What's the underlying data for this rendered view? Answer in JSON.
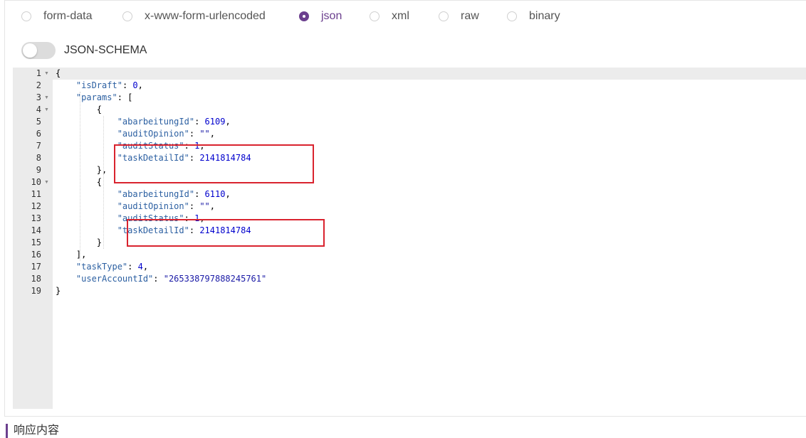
{
  "body_types": [
    {
      "label": "form-data",
      "checked": false
    },
    {
      "label": "x-www-form-urlencoded",
      "checked": false
    },
    {
      "label": "json",
      "checked": true
    },
    {
      "label": "xml",
      "checked": false
    },
    {
      "label": "raw",
      "checked": false
    },
    {
      "label": "binary",
      "checked": false
    }
  ],
  "schema_toggle": {
    "label": "JSON-SCHEMA",
    "on": false
  },
  "editor": {
    "lines": [
      [
        {
          "t": "p",
          "v": "{"
        }
      ],
      [
        {
          "t": "p",
          "v": "    "
        },
        {
          "t": "k",
          "v": "\"isDraft\""
        },
        {
          "t": "p",
          "v": ": "
        },
        {
          "t": "n",
          "v": "0"
        },
        {
          "t": "p",
          "v": ","
        }
      ],
      [
        {
          "t": "p",
          "v": "    "
        },
        {
          "t": "k",
          "v": "\"params\""
        },
        {
          "t": "p",
          "v": ": ["
        }
      ],
      [
        {
          "t": "p",
          "v": "        {"
        }
      ],
      [
        {
          "t": "p",
          "v": "            "
        },
        {
          "t": "k",
          "v": "\"abarbeitungId\""
        },
        {
          "t": "p",
          "v": ": "
        },
        {
          "t": "n",
          "v": "6109"
        },
        {
          "t": "p",
          "v": ","
        }
      ],
      [
        {
          "t": "p",
          "v": "            "
        },
        {
          "t": "k",
          "v": "\"auditOpinion\""
        },
        {
          "t": "p",
          "v": ": "
        },
        {
          "t": "s",
          "v": "\"\""
        },
        {
          "t": "p",
          "v": ","
        }
      ],
      [
        {
          "t": "p",
          "v": "            "
        },
        {
          "t": "k",
          "v": "\"auditStatus\""
        },
        {
          "t": "p",
          "v": ": "
        },
        {
          "t": "n",
          "v": "1"
        },
        {
          "t": "p",
          "v": ","
        }
      ],
      [
        {
          "t": "p",
          "v": "            "
        },
        {
          "t": "k",
          "v": "\"taskDetailId\""
        },
        {
          "t": "p",
          "v": ": "
        },
        {
          "t": "n",
          "v": "2141814784"
        }
      ],
      [
        {
          "t": "p",
          "v": "        },"
        }
      ],
      [
        {
          "t": "p",
          "v": "        {"
        }
      ],
      [
        {
          "t": "p",
          "v": "            "
        },
        {
          "t": "k",
          "v": "\"abarbeitungId\""
        },
        {
          "t": "p",
          "v": ": "
        },
        {
          "t": "n",
          "v": "6110"
        },
        {
          "t": "p",
          "v": ","
        }
      ],
      [
        {
          "t": "p",
          "v": "            "
        },
        {
          "t": "k",
          "v": "\"auditOpinion\""
        },
        {
          "t": "p",
          "v": ": "
        },
        {
          "t": "s",
          "v": "\"\""
        },
        {
          "t": "p",
          "v": ","
        }
      ],
      [
        {
          "t": "p",
          "v": "            "
        },
        {
          "t": "k",
          "v": "\"auditStatus\""
        },
        {
          "t": "p",
          "v": ": "
        },
        {
          "t": "n",
          "v": "1"
        },
        {
          "t": "p",
          "v": ","
        }
      ],
      [
        {
          "t": "p",
          "v": "            "
        },
        {
          "t": "k",
          "v": "\"taskDetailId\""
        },
        {
          "t": "p",
          "v": ": "
        },
        {
          "t": "n",
          "v": "2141814784"
        }
      ],
      [
        {
          "t": "p",
          "v": "        }"
        }
      ],
      [
        {
          "t": "p",
          "v": "    ],"
        }
      ],
      [
        {
          "t": "p",
          "v": "    "
        },
        {
          "t": "k",
          "v": "\"taskType\""
        },
        {
          "t": "p",
          "v": ": "
        },
        {
          "t": "n",
          "v": "4"
        },
        {
          "t": "p",
          "v": ","
        }
      ],
      [
        {
          "t": "p",
          "v": "    "
        },
        {
          "t": "k",
          "v": "\"userAccountId\""
        },
        {
          "t": "p",
          "v": ": "
        },
        {
          "t": "s",
          "v": "\"265338797888245761\""
        }
      ],
      [
        {
          "t": "p",
          "v": "}"
        }
      ]
    ],
    "foldable_lines": [
      1,
      3,
      4,
      10
    ]
  },
  "section": {
    "response_title": "响应内容"
  },
  "colors": {
    "accent": "#6b3f8e",
    "highlight_box": "#d9232e"
  }
}
